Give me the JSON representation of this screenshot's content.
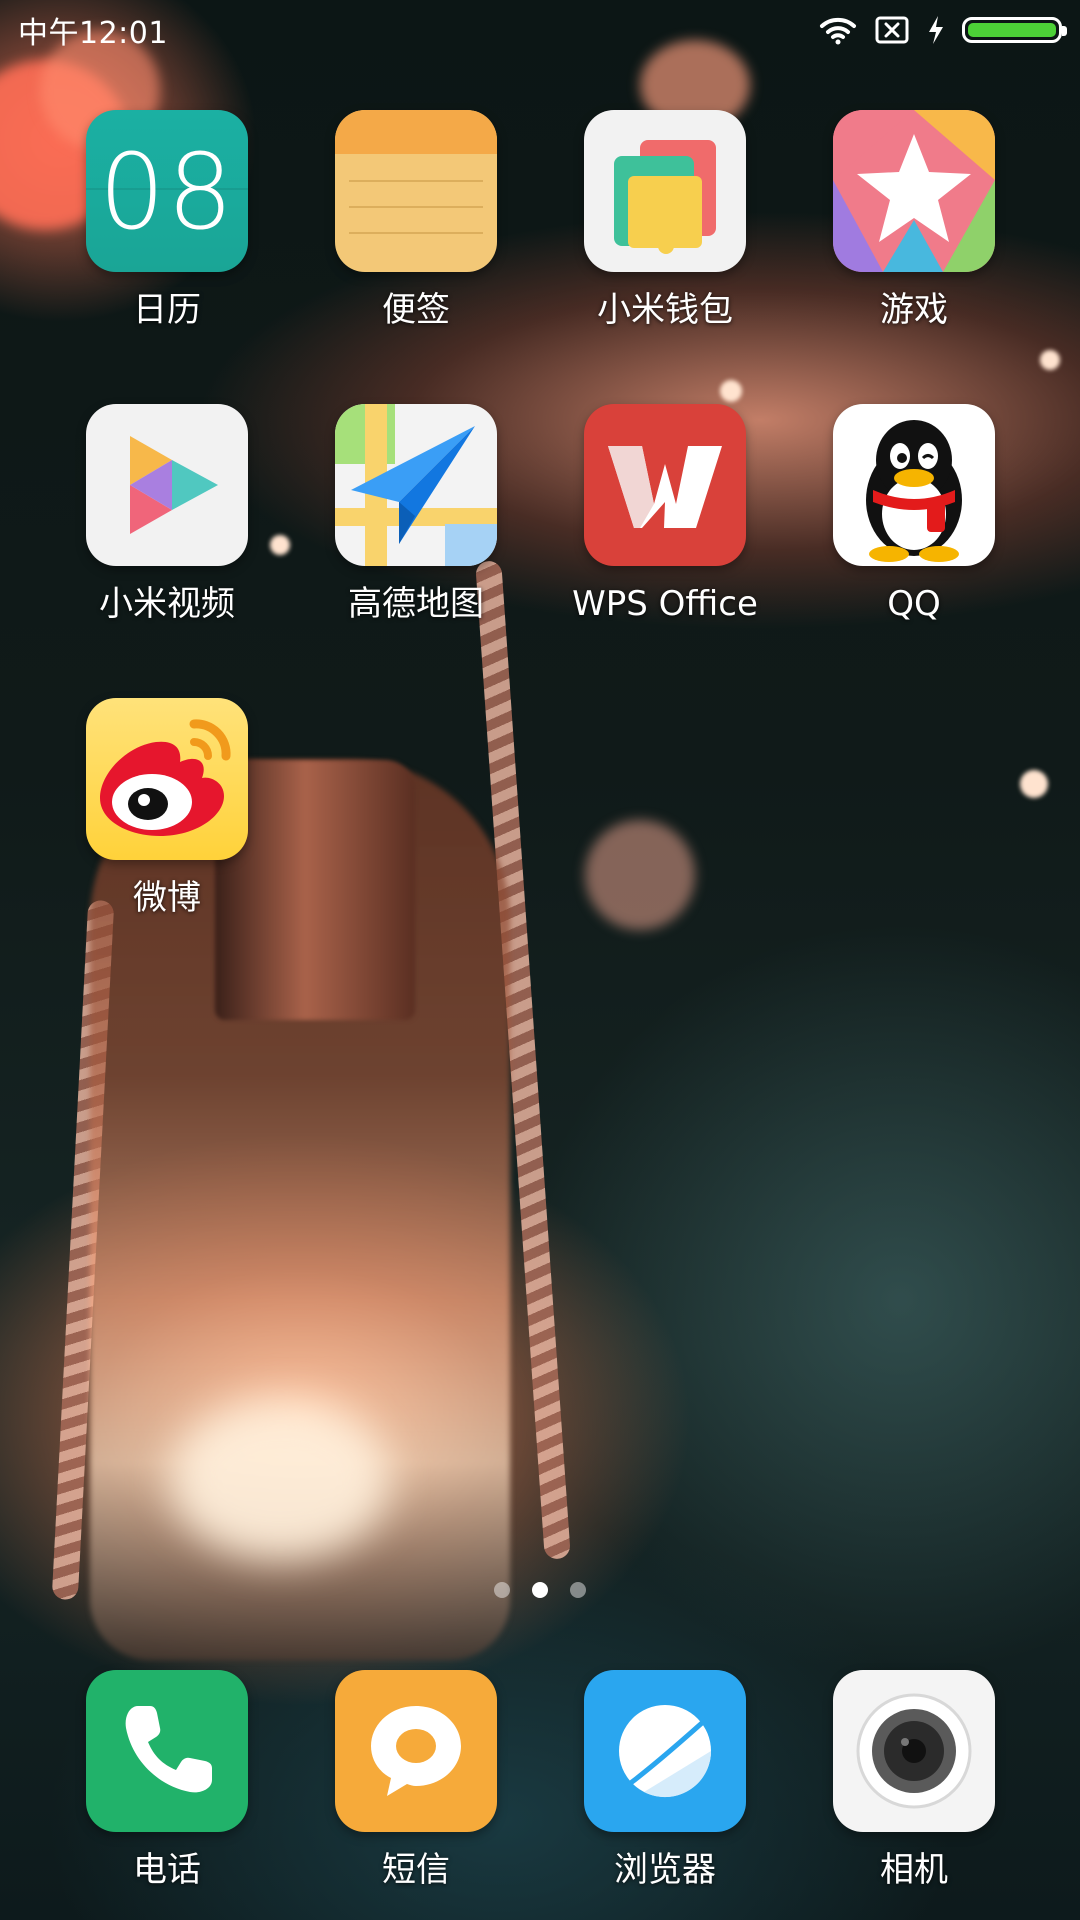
{
  "status_bar": {
    "time": "中午12:01",
    "icons": [
      "wifi-icon",
      "no-sim-icon",
      "charging-icon",
      "battery-icon"
    ],
    "battery_level": 1.0,
    "battery_color": "#4cd137"
  },
  "apps": [
    {
      "label": "日历",
      "icon": "calendar-icon",
      "day": "08",
      "color": "#19a89d"
    },
    {
      "label": "便签",
      "icon": "notes-icon",
      "color": "#f3c877"
    },
    {
      "label": "小米钱包",
      "icon": "wallet-icon",
      "color": "#f2f2f2"
    },
    {
      "label": "游戏",
      "icon": "games-icon",
      "color": "#f07b8a"
    },
    {
      "label": "小米视频",
      "icon": "video-icon",
      "color": "#f2f2f2"
    },
    {
      "label": "高德地图",
      "icon": "amap-icon",
      "color": "#f3f3f3"
    },
    {
      "label": "WPS Office",
      "icon": "wps-icon",
      "color": "#d9413a"
    },
    {
      "label": "QQ",
      "icon": "qq-penguin-icon",
      "color": "#ffffff"
    },
    {
      "label": "微博",
      "icon": "weibo-icon",
      "color": "#ffd84a"
    }
  ],
  "page_indicator": {
    "pages": 3,
    "current": 2
  },
  "dock": [
    {
      "label": "电话",
      "icon": "phone-icon",
      "color": "#21b26a"
    },
    {
      "label": "短信",
      "icon": "message-icon",
      "color": "#f6aa3a"
    },
    {
      "label": "浏览器",
      "icon": "browser-icon",
      "color": "#2aa6ef"
    },
    {
      "label": "相机",
      "icon": "camera-icon",
      "color": "#f4f4f4"
    }
  ]
}
